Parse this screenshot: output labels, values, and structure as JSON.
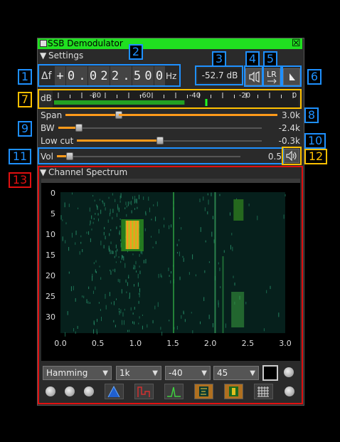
{
  "window": {
    "title": "SSB Demodulator",
    "close_glyph": "☒"
  },
  "settings_section": {
    "label": "Settings",
    "arrow": "▼"
  },
  "delta_f": {
    "label": "Δf",
    "digits": [
      "+",
      "0",
      ".",
      "0",
      "2",
      "2",
      ".",
      "5",
      "0",
      "0"
    ],
    "unit": "Hz"
  },
  "power": {
    "value": "-52.7",
    "unit": "dB"
  },
  "buttons": {
    "binaural_icon": "binaural-icon",
    "lr_label": "LR",
    "spectrum_flip_icon": "spectrum-flip-icon"
  },
  "meter": {
    "label": "dB",
    "ticks": [
      "-80",
      "-60",
      "-40",
      "-20",
      "0"
    ],
    "level_fraction": 0.53,
    "peak_fraction": 0.62,
    "level_color": "#22a022",
    "peak_color": "#22ff22"
  },
  "sliders": {
    "span": {
      "label": "Span",
      "value": "3.0k",
      "position": 0.25
    },
    "bw": {
      "label": "BW",
      "value": "-2.4k",
      "position": 0.1
    },
    "lowcut": {
      "label": "Low cut",
      "value": "-0.3k",
      "position": 0.45
    },
    "vol": {
      "label": "Vol",
      "value": "0.5",
      "position": 0.07
    }
  },
  "mute_icon": "speaker-icon",
  "spectrum_section": {
    "label": "Channel Spectrum",
    "arrow": "▼"
  },
  "waterfall": {
    "y_ticks": [
      "0",
      "5",
      "10",
      "15",
      "20",
      "25",
      "30"
    ],
    "x_ticks": [
      "0.0",
      "0.5",
      "1.0",
      "1.5",
      "2.0",
      "2.5",
      "3.0"
    ]
  },
  "controls": {
    "window_fn": "Hamming",
    "fft_size": "1k",
    "ref_level": "-40",
    "range": "45"
  },
  "callouts": [
    "1",
    "2",
    "3",
    "4",
    "5",
    "6",
    "7",
    "8",
    "9",
    "10",
    "11",
    "12",
    "13"
  ],
  "colors": {
    "title_bar": "#20e020",
    "accent_blue": "#1e90ff",
    "accent_yellow": "#ffc000",
    "accent_red": "#e01010",
    "slider_fill": "#ff9a1a"
  }
}
